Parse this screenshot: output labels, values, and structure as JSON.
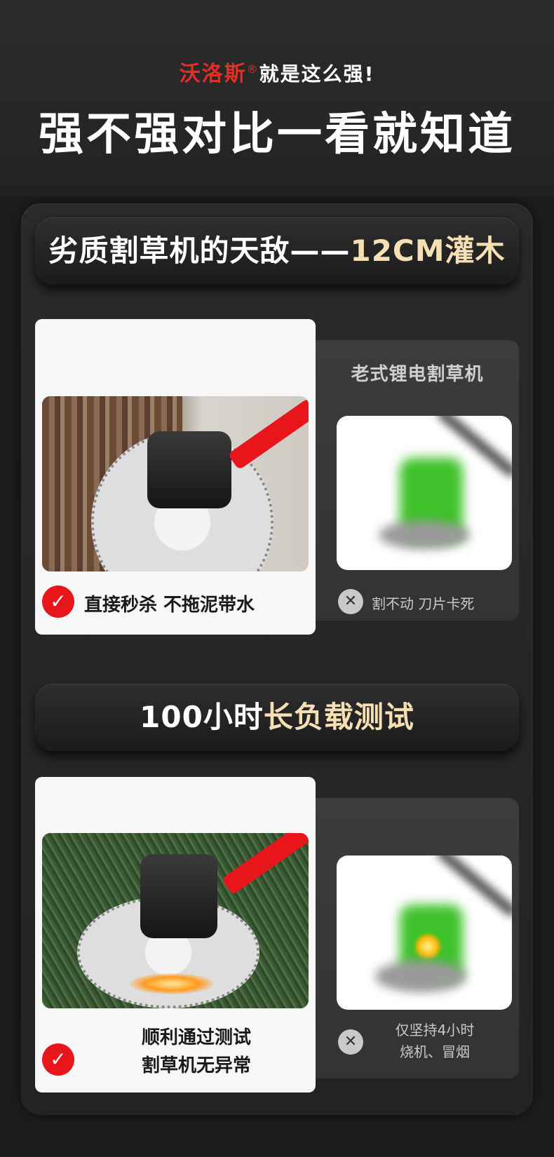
{
  "header": {
    "brand": "沃洛斯",
    "brand_mark": "®",
    "brand_suffix": "就是这么强!",
    "title": "强不强对比一看就知道"
  },
  "sections": [
    {
      "banner_white": "劣质割草机的天敌——",
      "banner_gold": "12CM灌木",
      "good": {
        "text": "直接秒杀 不拖泥带水",
        "icon": "check-icon"
      },
      "bad": {
        "title": "老式锂电割草机",
        "text": "割不动 刀片卡死",
        "icon": "x-icon"
      }
    },
    {
      "banner_white": "100小时",
      "banner_gold": "长负载测试",
      "good": {
        "line1": "顺利通过测试",
        "line2": "割草机无异常",
        "icon": "check-icon"
      },
      "bad": {
        "line1": "仅坚持4小时",
        "line2": "烧机、冒烟",
        "icon": "x-icon"
      }
    }
  ],
  "colors": {
    "brand_red": "#e52d27",
    "gold": "#f5dfb3",
    "check_red": "#e8151b",
    "panel": "#262626"
  }
}
